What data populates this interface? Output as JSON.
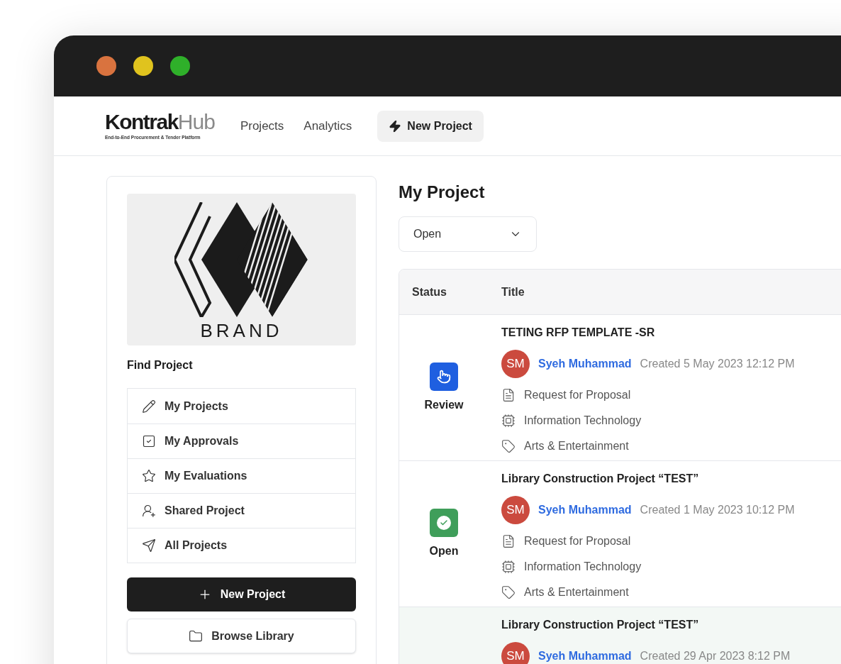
{
  "window": {
    "controls": [
      {
        "color": "#d9733f"
      },
      {
        "color": "#e0c31e"
      },
      {
        "color": "#2fb02a"
      }
    ]
  },
  "nav": {
    "logo": {
      "name_main": "Kontrak",
      "name_accent": "Hub",
      "tagline": "End-to-End Procurement & Tender Platform"
    },
    "links": [
      {
        "label": "Projects",
        "selected": false
      },
      {
        "label": "Analytics",
        "selected": false
      }
    ],
    "action": {
      "label": "New Project"
    }
  },
  "sidebar": {
    "brand_image": {
      "caption": "BRAND"
    },
    "heading": "Find Project",
    "items": [
      {
        "kind": "pencil",
        "label": "My Projects"
      },
      {
        "kind": "checkbox",
        "label": "My Approvals"
      },
      {
        "kind": "star",
        "label": "My Evaluations"
      },
      {
        "kind": "user",
        "label": "Shared Project"
      },
      {
        "kind": "send",
        "label": "All Projects"
      }
    ],
    "primary_button": "New Project",
    "secondary_button": "Browse Library"
  },
  "main": {
    "title": "My Project",
    "filter": {
      "value": "Open"
    },
    "table": {
      "columns": [
        "Status",
        "Title"
      ],
      "rows": [
        {
          "selected": false,
          "status": {
            "kind": "review",
            "label": "Review"
          },
          "title": "TETING RFP TEMPLATE -SR",
          "avatar": "SM",
          "author": "Syeh Muhammad",
          "created": "Created 5 May 2023 12:12 PM",
          "details": [
            {
              "kind": "document",
              "text": "Request for Proposal"
            },
            {
              "kind": "chip",
              "text": "Information Technology"
            },
            {
              "kind": "tag",
              "text": "Arts & Entertainment"
            }
          ]
        },
        {
          "selected": false,
          "status": {
            "kind": "open",
            "label": "Open"
          },
          "title": "Library Construction Project “TEST”",
          "avatar": "SM",
          "author": "Syeh Muhammad",
          "created": "Created 1 May 2023 10:12 PM",
          "details": [
            {
              "kind": "document",
              "text": "Request for Proposal"
            },
            {
              "kind": "chip",
              "text": "Information Technology"
            },
            {
              "kind": "tag",
              "text": "Arts & Entertainment"
            }
          ]
        },
        {
          "selected": true,
          "status": {
            "kind": "blank"
          },
          "title": "Library Construction Project “TEST”",
          "avatar": "SM",
          "author": "Syeh Muhammad",
          "created": "Created 29 Apr 2023 8:12 PM",
          "details": []
        }
      ]
    }
  }
}
